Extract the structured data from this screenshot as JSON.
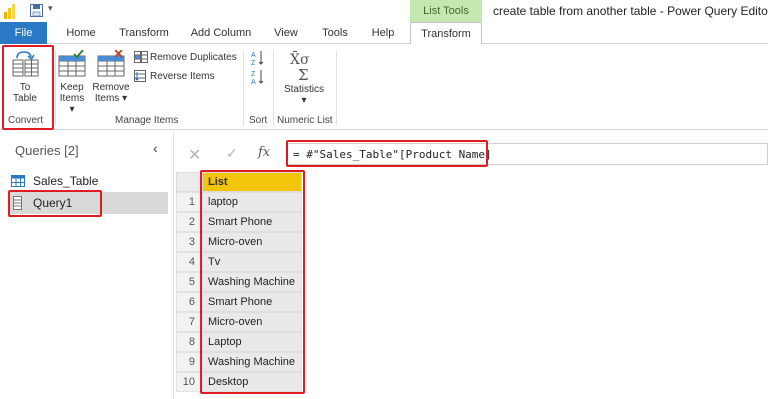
{
  "titlebar": {
    "context_tab": "List Tools",
    "window_title": "create table from another table - Power Query Editor"
  },
  "tabs": [
    "File",
    "Home",
    "Transform",
    "Add Column",
    "View",
    "Tools",
    "Help",
    "Transform"
  ],
  "ribbon": {
    "convert": {
      "button_line1": "To",
      "button_line2": "Table",
      "group_label": "Convert"
    },
    "manage_items": {
      "keep_line1": "Keep",
      "keep_line2": "Items",
      "remove_line1": "Remove",
      "remove_line2": "Items",
      "remove_duplicates": "Remove Duplicates",
      "reverse_items": "Reverse Items",
      "group_label": "Manage Items"
    },
    "sort": {
      "group_label": "Sort"
    },
    "numeric_list": {
      "statistics": "Statistics",
      "group_label": "Numeric List"
    }
  },
  "queries": {
    "title": "Queries [2]",
    "items": [
      "Sales_Table",
      "Query1"
    ]
  },
  "formula": "= #\"Sales_Table\"[Product Name]",
  "grid": {
    "column": "List",
    "rows": [
      {
        "n": "1",
        "v": "laptop"
      },
      {
        "n": "2",
        "v": "Smart Phone"
      },
      {
        "n": "3",
        "v": "Micro-oven"
      },
      {
        "n": "4",
        "v": "Tv"
      },
      {
        "n": "5",
        "v": "Washing Machine"
      },
      {
        "n": "6",
        "v": "Smart Phone"
      },
      {
        "n": "7",
        "v": "Micro-oven"
      },
      {
        "n": "8",
        "v": "Laptop"
      },
      {
        "n": "9",
        "v": "Washing Machine"
      },
      {
        "n": "10",
        "v": "Desktop"
      }
    ]
  },
  "colors": {
    "file_tab": "#2b78c5",
    "context_tab": "#c5e8b0",
    "column_header": "#f3c50a",
    "highlight_box": "#e11b22"
  }
}
